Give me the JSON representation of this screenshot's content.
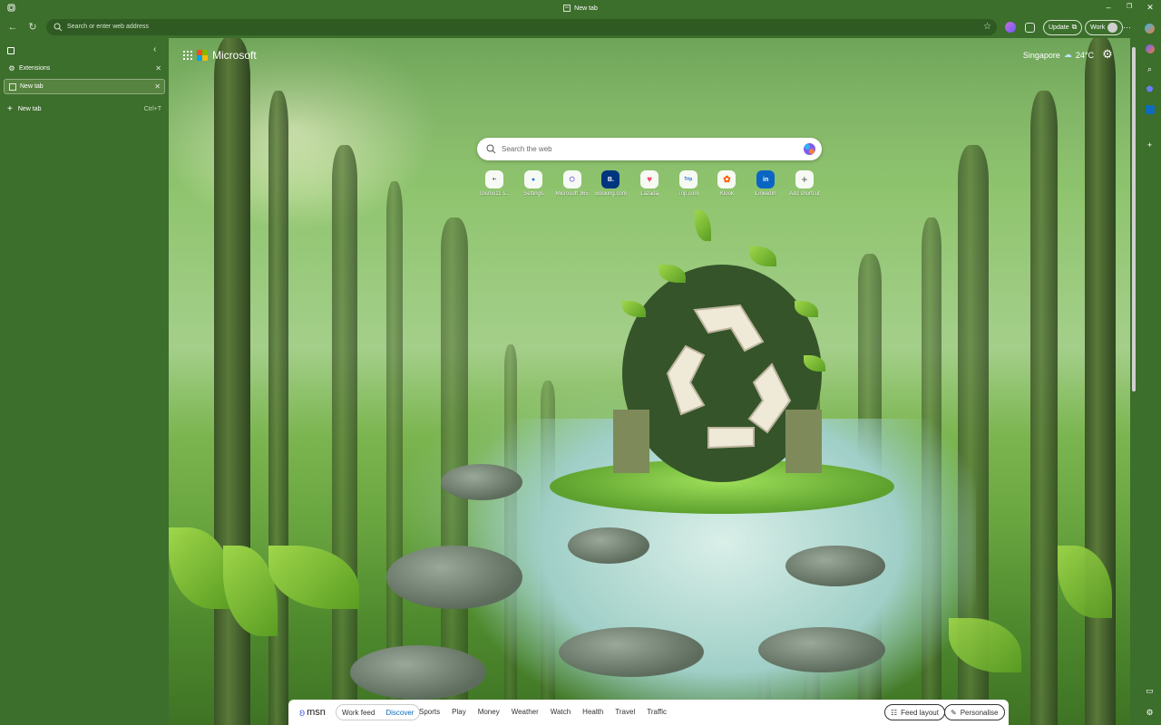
{
  "window": {
    "title": "New tab",
    "minimize": "–",
    "restore": "❐",
    "close": "✕"
  },
  "toolbar": {
    "address_placeholder": "Search or enter web address",
    "update_label": "Update",
    "profile_label": "Work",
    "more": "···"
  },
  "sidebar": {
    "tabs": [
      {
        "label": "Extensions",
        "active": false
      },
      {
        "label": "New tab",
        "active": true
      }
    ],
    "new_tab_label": "New tab",
    "new_tab_shortcut": "Ctrl+T"
  },
  "ntp": {
    "brand": "Microsoft",
    "weather": {
      "city": "Singapore",
      "temp": "24°C"
    },
    "search_placeholder": "Search the web",
    "shortcuts": [
      {
        "name": "cosmo11 s...",
        "glyph": "•·"
      },
      {
        "name": "Settings",
        "glyph": "●"
      },
      {
        "name": "Microsoft 365",
        "glyph": "⬡"
      },
      {
        "name": "Booking.com",
        "glyph": "B."
      },
      {
        "name": "Lazada",
        "glyph": "♥"
      },
      {
        "name": "Trip.com",
        "glyph": "Trip"
      },
      {
        "name": "Klook",
        "glyph": "✿"
      },
      {
        "name": "LinkedIn",
        "glyph": "in"
      },
      {
        "name": "Add shortcut",
        "glyph": "+"
      }
    ]
  },
  "msn": {
    "logo": "msn",
    "feed_tabs": [
      "Work feed",
      "Discover"
    ],
    "selected_feed": "Discover",
    "categories": [
      "Sports",
      "Play",
      "Money",
      "Weather",
      "Watch",
      "Health",
      "Travel",
      "Traffic"
    ],
    "feed_layout_label": "Feed layout",
    "personalise_label": "Personalise"
  },
  "colors": {
    "frame": "#3c6e2c",
    "accent": "#0f6cbd"
  }
}
